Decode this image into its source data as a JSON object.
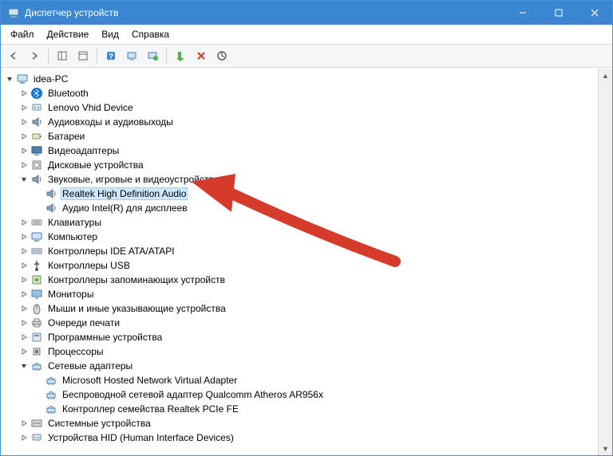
{
  "window": {
    "title": "Диспетчер устройств"
  },
  "menu": {
    "file": "Файл",
    "action": "Действие",
    "view": "Вид",
    "help": "Справка"
  },
  "tree": {
    "root": "idea-PC",
    "bluetooth": "Bluetooth",
    "lenovo_vhid": "Lenovo Vhid Device",
    "audio_io": "Аудиовходы и аудиовыходы",
    "batteries": "Батареи",
    "video_adapters": "Видеоадаптеры",
    "disk_drives": "Дисковые устройства",
    "sound_game_video": "Звуковые, игровые и видеоустройства",
    "realtek_audio": "Realtek High Definition Audio",
    "intel_display_audio": "Аудио Intel(R) для дисплеев",
    "keyboards": "Клавиатуры",
    "computer": "Компьютер",
    "ide_ata": "Контроллеры IDE ATA/ATAPI",
    "usb_ctrl": "Контроллеры USB",
    "storage_ctrl": "Контроллеры запоминающих устройств",
    "monitors": "Мониторы",
    "mice": "Мыши и иные указывающие устройства",
    "print_queues": "Очереди печати",
    "software_devices": "Программные устройства",
    "processors": "Процессоры",
    "network_adapters": "Сетевые адаптеры",
    "net_hosted": "Microsoft Hosted Network Virtual Adapter",
    "net_atheros": "Беспроводной сетевой адаптер Qualcomm Atheros AR956x",
    "net_realtek": "Контроллер семейства Realtek PCIe FE",
    "system_devices": "Системные устройства",
    "hid_devices": "Устройства HID (Human Interface Devices)"
  },
  "icons": {
    "computer": "computer",
    "bluetooth": "bluetooth",
    "hid": "hid",
    "speaker": "speaker",
    "battery": "battery",
    "display": "display",
    "disk": "disk",
    "keyboard": "keyboard",
    "ide": "ide",
    "usb": "usb",
    "storage": "storage",
    "monitor": "monitor",
    "mouse": "mouse",
    "printer": "printer",
    "software": "software",
    "cpu": "cpu",
    "network": "network",
    "system": "system"
  },
  "colors": {
    "titlebar": "#3b86d1",
    "selection": "#cde8ff",
    "arrow": "#d63a2a"
  }
}
